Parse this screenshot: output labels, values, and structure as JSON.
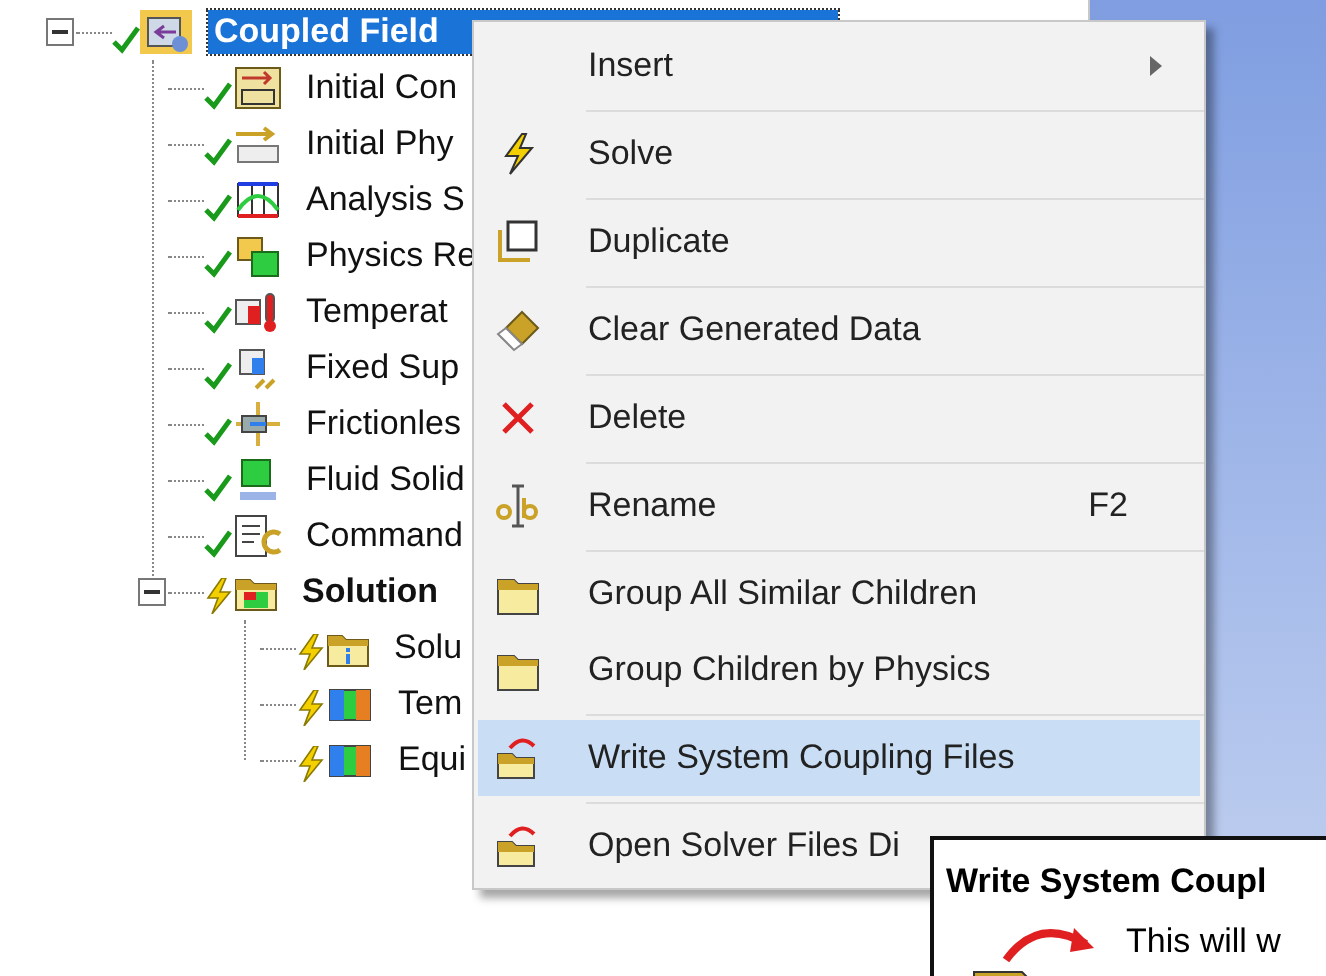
{
  "tree": [
    {
      "label": "Coupled Field",
      "kind": "model",
      "solved": true,
      "bold": true,
      "selected": true,
      "expanded": true,
      "children": [
        {
          "label": "Initial Con",
          "kind": "condition",
          "solved": true,
          "bold": false,
          "selected": false
        },
        {
          "label": "Initial Phy",
          "kind": "timezero",
          "solved": true,
          "bold": false,
          "selected": false
        },
        {
          "label": "Analysis S",
          "kind": "settings",
          "solved": true,
          "bold": false,
          "selected": false
        },
        {
          "label": "Physics Re",
          "kind": "region",
          "solved": true,
          "bold": false,
          "selected": false
        },
        {
          "label": "Temperat",
          "kind": "temperature",
          "solved": true,
          "bold": false,
          "selected": false
        },
        {
          "label": "Fixed Sup",
          "kind": "support",
          "solved": true,
          "bold": false,
          "selected": false
        },
        {
          "label": "Frictionles",
          "kind": "frictionless",
          "solved": true,
          "bold": false,
          "selected": false
        },
        {
          "label": "Fluid Solid",
          "kind": "interface",
          "solved": true,
          "bold": false,
          "selected": false
        },
        {
          "label": "Command",
          "kind": "commands",
          "solved": true,
          "bold": false,
          "selected": false
        },
        {
          "label": "Solution",
          "kind": "folder",
          "solved": false,
          "bold": true,
          "selected": false,
          "expanded": true,
          "children": [
            {
              "label": "Solu",
              "kind": "info",
              "solved": false,
              "bold": false,
              "selected": false
            },
            {
              "label": "Tem",
              "kind": "result",
              "solved": false,
              "bold": false,
              "selected": false
            },
            {
              "label": "Equi",
              "kind": "result",
              "solved": false,
              "bold": false,
              "selected": false
            }
          ]
        }
      ]
    }
  ],
  "context_menu": [
    {
      "label": "Insert",
      "kind": "submenu",
      "selected": false,
      "divider_after": true
    },
    {
      "label": "Solve",
      "kind": "solve",
      "selected": false,
      "divider_after": true
    },
    {
      "label": "Duplicate",
      "kind": "duplicate",
      "selected": false,
      "divider_after": true
    },
    {
      "label": "Clear Generated Data",
      "kind": "eraser",
      "selected": false,
      "divider_after": true
    },
    {
      "label": "Delete",
      "kind": "delete",
      "selected": false,
      "divider_after": true
    },
    {
      "label": "Rename",
      "kind": "rename",
      "shortcut": "F2",
      "selected": false,
      "divider_after": true
    },
    {
      "label": "Group All Similar Children",
      "kind": "folder",
      "selected": false,
      "divider_after": false
    },
    {
      "label": "Group Children by Physics",
      "kind": "folder",
      "selected": false,
      "divider_after": true
    },
    {
      "label": "Write System Coupling Files",
      "kind": "coupling",
      "selected": true,
      "divider_after": true
    },
    {
      "label": "Open Solver Files Di",
      "kind": "coupling",
      "selected": false,
      "divider_after": false
    }
  ],
  "tooltip": {
    "title": "Write System Coupl",
    "text": "This will w"
  }
}
